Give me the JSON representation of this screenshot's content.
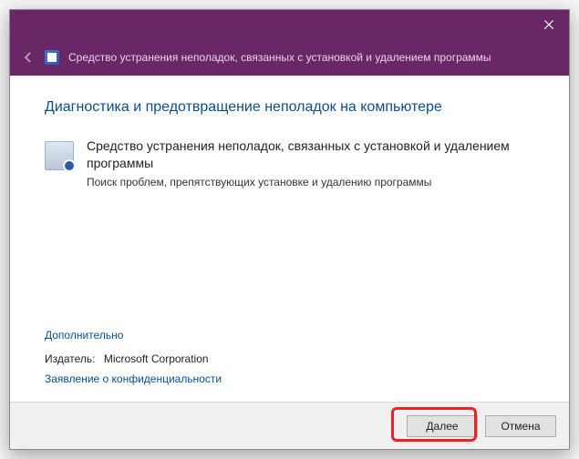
{
  "titlebar": {
    "close_aria": "Close"
  },
  "header": {
    "title": "Средство устранения неполадок, связанных с установкой и удалением программы"
  },
  "content": {
    "heading": "Диагностика и предотвращение неполадок на компьютере",
    "troubleshooter": {
      "title": "Средство устранения неполадок, связанных с установкой и удалением программы",
      "description": "Поиск проблем, препятствующих установке и удалению программы"
    },
    "advanced_link": "Дополнительно",
    "publisher_label": "Издатель:",
    "publisher_value": "Microsoft Corporation",
    "privacy_link": "Заявление о конфиденциальности"
  },
  "footer": {
    "next": "Далее",
    "cancel": "Отмена"
  }
}
